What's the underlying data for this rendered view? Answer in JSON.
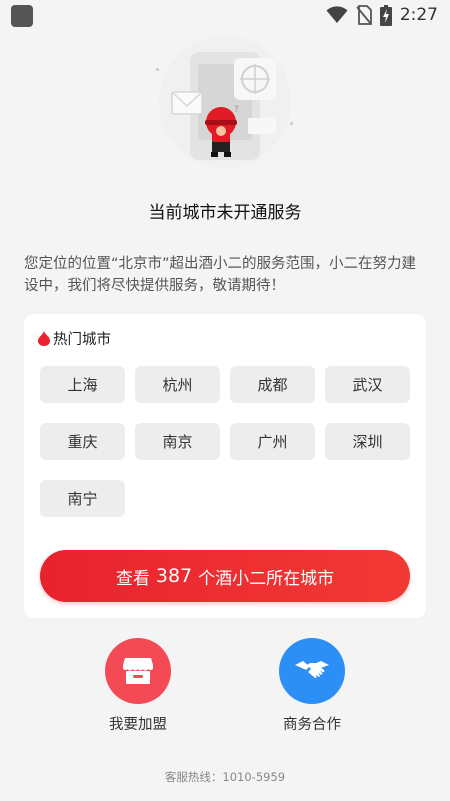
{
  "status_bar": {
    "time": "2:27"
  },
  "page": {
    "title": "当前城市未开通服务",
    "description": "您定位的位置“北京市”超出酒小二的服务范围，小二在努力建设中，我们将尽快提供服务，敬请期待！"
  },
  "hot_cities": {
    "header": "热门城市",
    "cities": [
      "上海",
      "杭州",
      "成都",
      "武汉",
      "重庆",
      "南京",
      "广州",
      "深圳",
      "南宁"
    ]
  },
  "cta": {
    "prefix": "查看",
    "count": "387",
    "suffix": "个酒小二所在城市"
  },
  "actions": [
    {
      "label": "我要加盟",
      "color": "#f44a56"
    },
    {
      "label": "商务合作",
      "color": "#2b8ff5"
    }
  ],
  "hotline": "客服热线：1010-5959",
  "colors": {
    "accent": "#e8222e",
    "background": "#f4f4f4"
  }
}
